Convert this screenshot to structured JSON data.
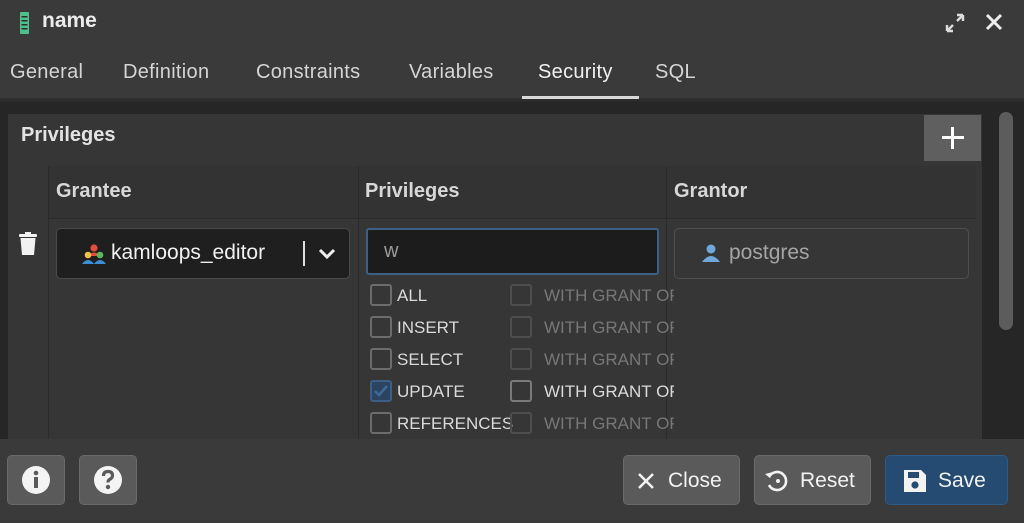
{
  "dialog": {
    "title": "name"
  },
  "tabs": [
    {
      "label": "General"
    },
    {
      "label": "Definition"
    },
    {
      "label": "Constraints"
    },
    {
      "label": "Variables"
    },
    {
      "label": "Security",
      "active": true
    },
    {
      "label": "SQL"
    }
  ],
  "privileges_section": {
    "title": "Privileges",
    "columns": {
      "grantee": "Grantee",
      "privileges": "Privileges",
      "grantor": "Grantor"
    },
    "row": {
      "grantee": "kamloops_editor",
      "privilege_search": "w",
      "grantor": "postgres",
      "options": [
        {
          "label": "ALL",
          "checked": false,
          "grant_label": "WITH GRANT OPTION",
          "grant_enabled": false
        },
        {
          "label": "INSERT",
          "checked": false,
          "grant_label": "WITH GRANT OPTION",
          "grant_enabled": false
        },
        {
          "label": "SELECT",
          "checked": false,
          "grant_label": "WITH GRANT OPTION",
          "grant_enabled": false
        },
        {
          "label": "UPDATE",
          "checked": true,
          "grant_label": "WITH GRANT OPTION",
          "grant_enabled": true
        },
        {
          "label": "REFERENCES",
          "checked": false,
          "grant_label": "WITH GRANT OPTION",
          "grant_enabled": false
        }
      ]
    }
  },
  "footer": {
    "close": "Close",
    "reset": "Reset",
    "save": "Save"
  },
  "colors": {
    "accent": "#254b72",
    "input_focus": "#3c5f86",
    "role_icon": "#e84b3c",
    "user_icon": "#6fa8dc"
  }
}
